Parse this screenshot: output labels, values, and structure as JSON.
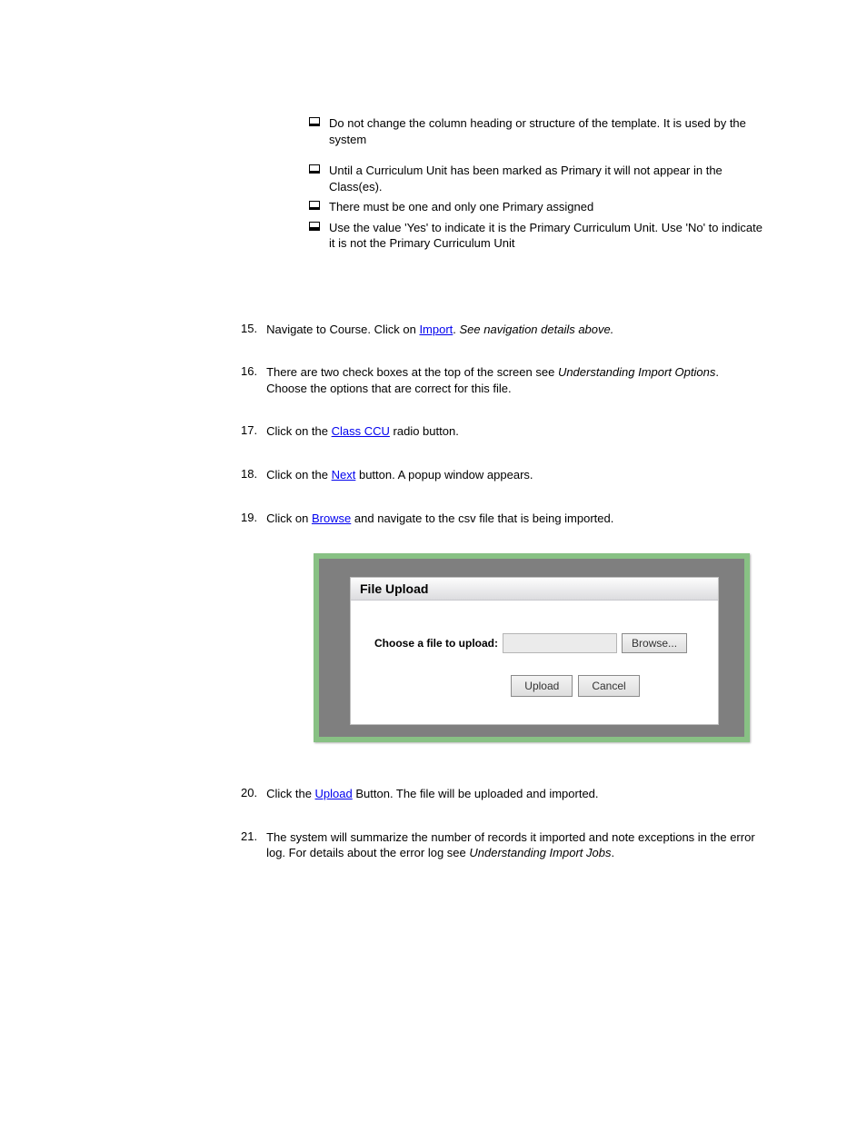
{
  "bullets": [
    "Do not change the column heading or structure of the template. It is used by the system",
    "Until a Curriculum Unit has been marked as Primary it will not appear in the Class(es).",
    "There must be one and only one Primary assigned",
    "Use the value 'Yes' to indicate it is the Primary Curriculum Unit. Use 'No' to indicate it is not the Primary Curriculum Unit"
  ],
  "steps": [
    {
      "num": "15.",
      "text_pre": "Navigate to Course. Click on ",
      "link": "Import",
      "click_plain": ". ",
      "note": "See navigation details above."
    },
    {
      "num": "16.",
      "text_pre": "There are two check boxes at the top of the screen see ",
      "italic": "Understanding Import Options",
      "after_italic": ". Choose the options that are correct for this file.",
      "note": ""
    },
    {
      "num": "17.",
      "text_pre": "Click on the ",
      "link": "Class CCU",
      "after_link": " radio button.",
      "note": ""
    },
    {
      "num": "18.",
      "text_pre": "Click on the ",
      "link": "Next",
      "after_link": " button. A popup window appears.",
      "note": ""
    },
    {
      "num": "19.",
      "text_pre": "Click on ",
      "link": "Browse",
      "after_link": " and navigate to the csv file that is being imported.",
      "note": ""
    },
    {
      "num": "20.",
      "text_pre": "Click the ",
      "link": "Upload",
      "after_link": " Button. The file will be uploaded and imported.",
      "note": ""
    },
    {
      "num": "21.",
      "text_pre": "The system will summarize the number of records it imported and note exceptions in the error log. For details about the error log see ",
      "italic": "Understanding Import Jobs",
      "after_italic": ".",
      "note": ""
    }
  ],
  "dialog": {
    "title": "File Upload",
    "choose_label": "Choose a file to upload:",
    "browse": "Browse...",
    "upload": "Upload",
    "cancel": "Cancel"
  }
}
